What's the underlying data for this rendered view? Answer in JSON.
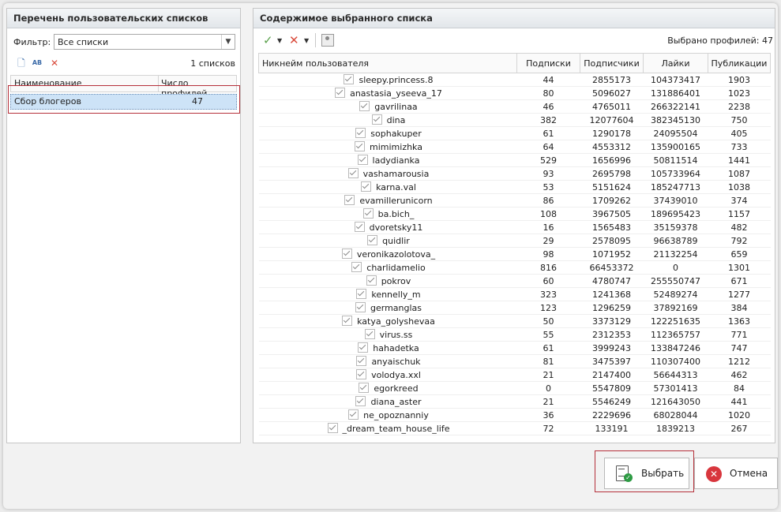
{
  "left_panel": {
    "title": "Перечень пользовательских списков",
    "filter_label": "Фильтр:",
    "filter_value": "Все списки",
    "count_label": "1 списков",
    "columns": [
      "Наименование",
      "Число профилей"
    ],
    "rows": [
      {
        "name": "Сбор блогеров",
        "count": "47"
      }
    ]
  },
  "right_panel": {
    "title": "Содержимое выбранного списка",
    "selected_label": "Выбрано профилей: 47",
    "columns": [
      "Никнейм пользователя",
      "Подписки",
      "Подписчики",
      "Лайки",
      "Публикации"
    ],
    "rows": [
      [
        "sleepy.princess.8",
        "44",
        "2855173",
        "104373417",
        "1903"
      ],
      [
        "anastasia_yseeva_17",
        "80",
        "5096027",
        "131886401",
        "1023"
      ],
      [
        "gavrilinaa",
        "46",
        "4765011",
        "266322141",
        "2238"
      ],
      [
        "dina",
        "382",
        "12077604",
        "382345130",
        "750"
      ],
      [
        "sophakuper",
        "61",
        "1290178",
        "24095504",
        "405"
      ],
      [
        "mimimizhka",
        "64",
        "4553312",
        "135900165",
        "733"
      ],
      [
        "ladydianka",
        "529",
        "1656996",
        "50811514",
        "1441"
      ],
      [
        "vashamarousia",
        "93",
        "2695798",
        "105733964",
        "1087"
      ],
      [
        "karna.val",
        "53",
        "5151624",
        "185247713",
        "1038"
      ],
      [
        "evamillerunicorn",
        "86",
        "1709262",
        "37439010",
        "374"
      ],
      [
        "ba.bich_",
        "108",
        "3967505",
        "189695423",
        "1157"
      ],
      [
        "dvoretsky11",
        "16",
        "1565483",
        "35159378",
        "482"
      ],
      [
        "quidlir",
        "29",
        "2578095",
        "96638789",
        "792"
      ],
      [
        "veronikazolotova_",
        "98",
        "1071952",
        "21132254",
        "659"
      ],
      [
        "charlidamelio",
        "816",
        "66453372",
        "0",
        "1301"
      ],
      [
        "pokrov",
        "60",
        "4780747",
        "255550747",
        "671"
      ],
      [
        "kennelly_m",
        "323",
        "1241368",
        "52489274",
        "1277"
      ],
      [
        "germanglas",
        "123",
        "1296259",
        "37892169",
        "384"
      ],
      [
        "katya_golyshevaa",
        "50",
        "3373129",
        "122251635",
        "1363"
      ],
      [
        "virus.ss",
        "55",
        "2312353",
        "112365757",
        "771"
      ],
      [
        "hahadetka",
        "61",
        "3999243",
        "133847246",
        "747"
      ],
      [
        "anyaischuk",
        "81",
        "3475397",
        "110307400",
        "1212"
      ],
      [
        "volodya.xxl",
        "21",
        "2147400",
        "56644313",
        "462"
      ],
      [
        "egorkreed",
        "0",
        "5547809",
        "57301413",
        "84"
      ],
      [
        "diana_aster",
        "21",
        "5546249",
        "121643050",
        "441"
      ],
      [
        "ne_opoznanniy",
        "36",
        "2229696",
        "68028044",
        "1020"
      ],
      [
        "_dream_team_house_life",
        "72",
        "133191",
        "1839213",
        "267"
      ]
    ]
  },
  "buttons": {
    "select": "Выбрать",
    "cancel": "Отмена"
  },
  "colors": {
    "highlight_border": "#b5303a",
    "selected_row": "#cde3f7",
    "check_green": "#5aa14b",
    "remove_red": "#d94b3c"
  }
}
